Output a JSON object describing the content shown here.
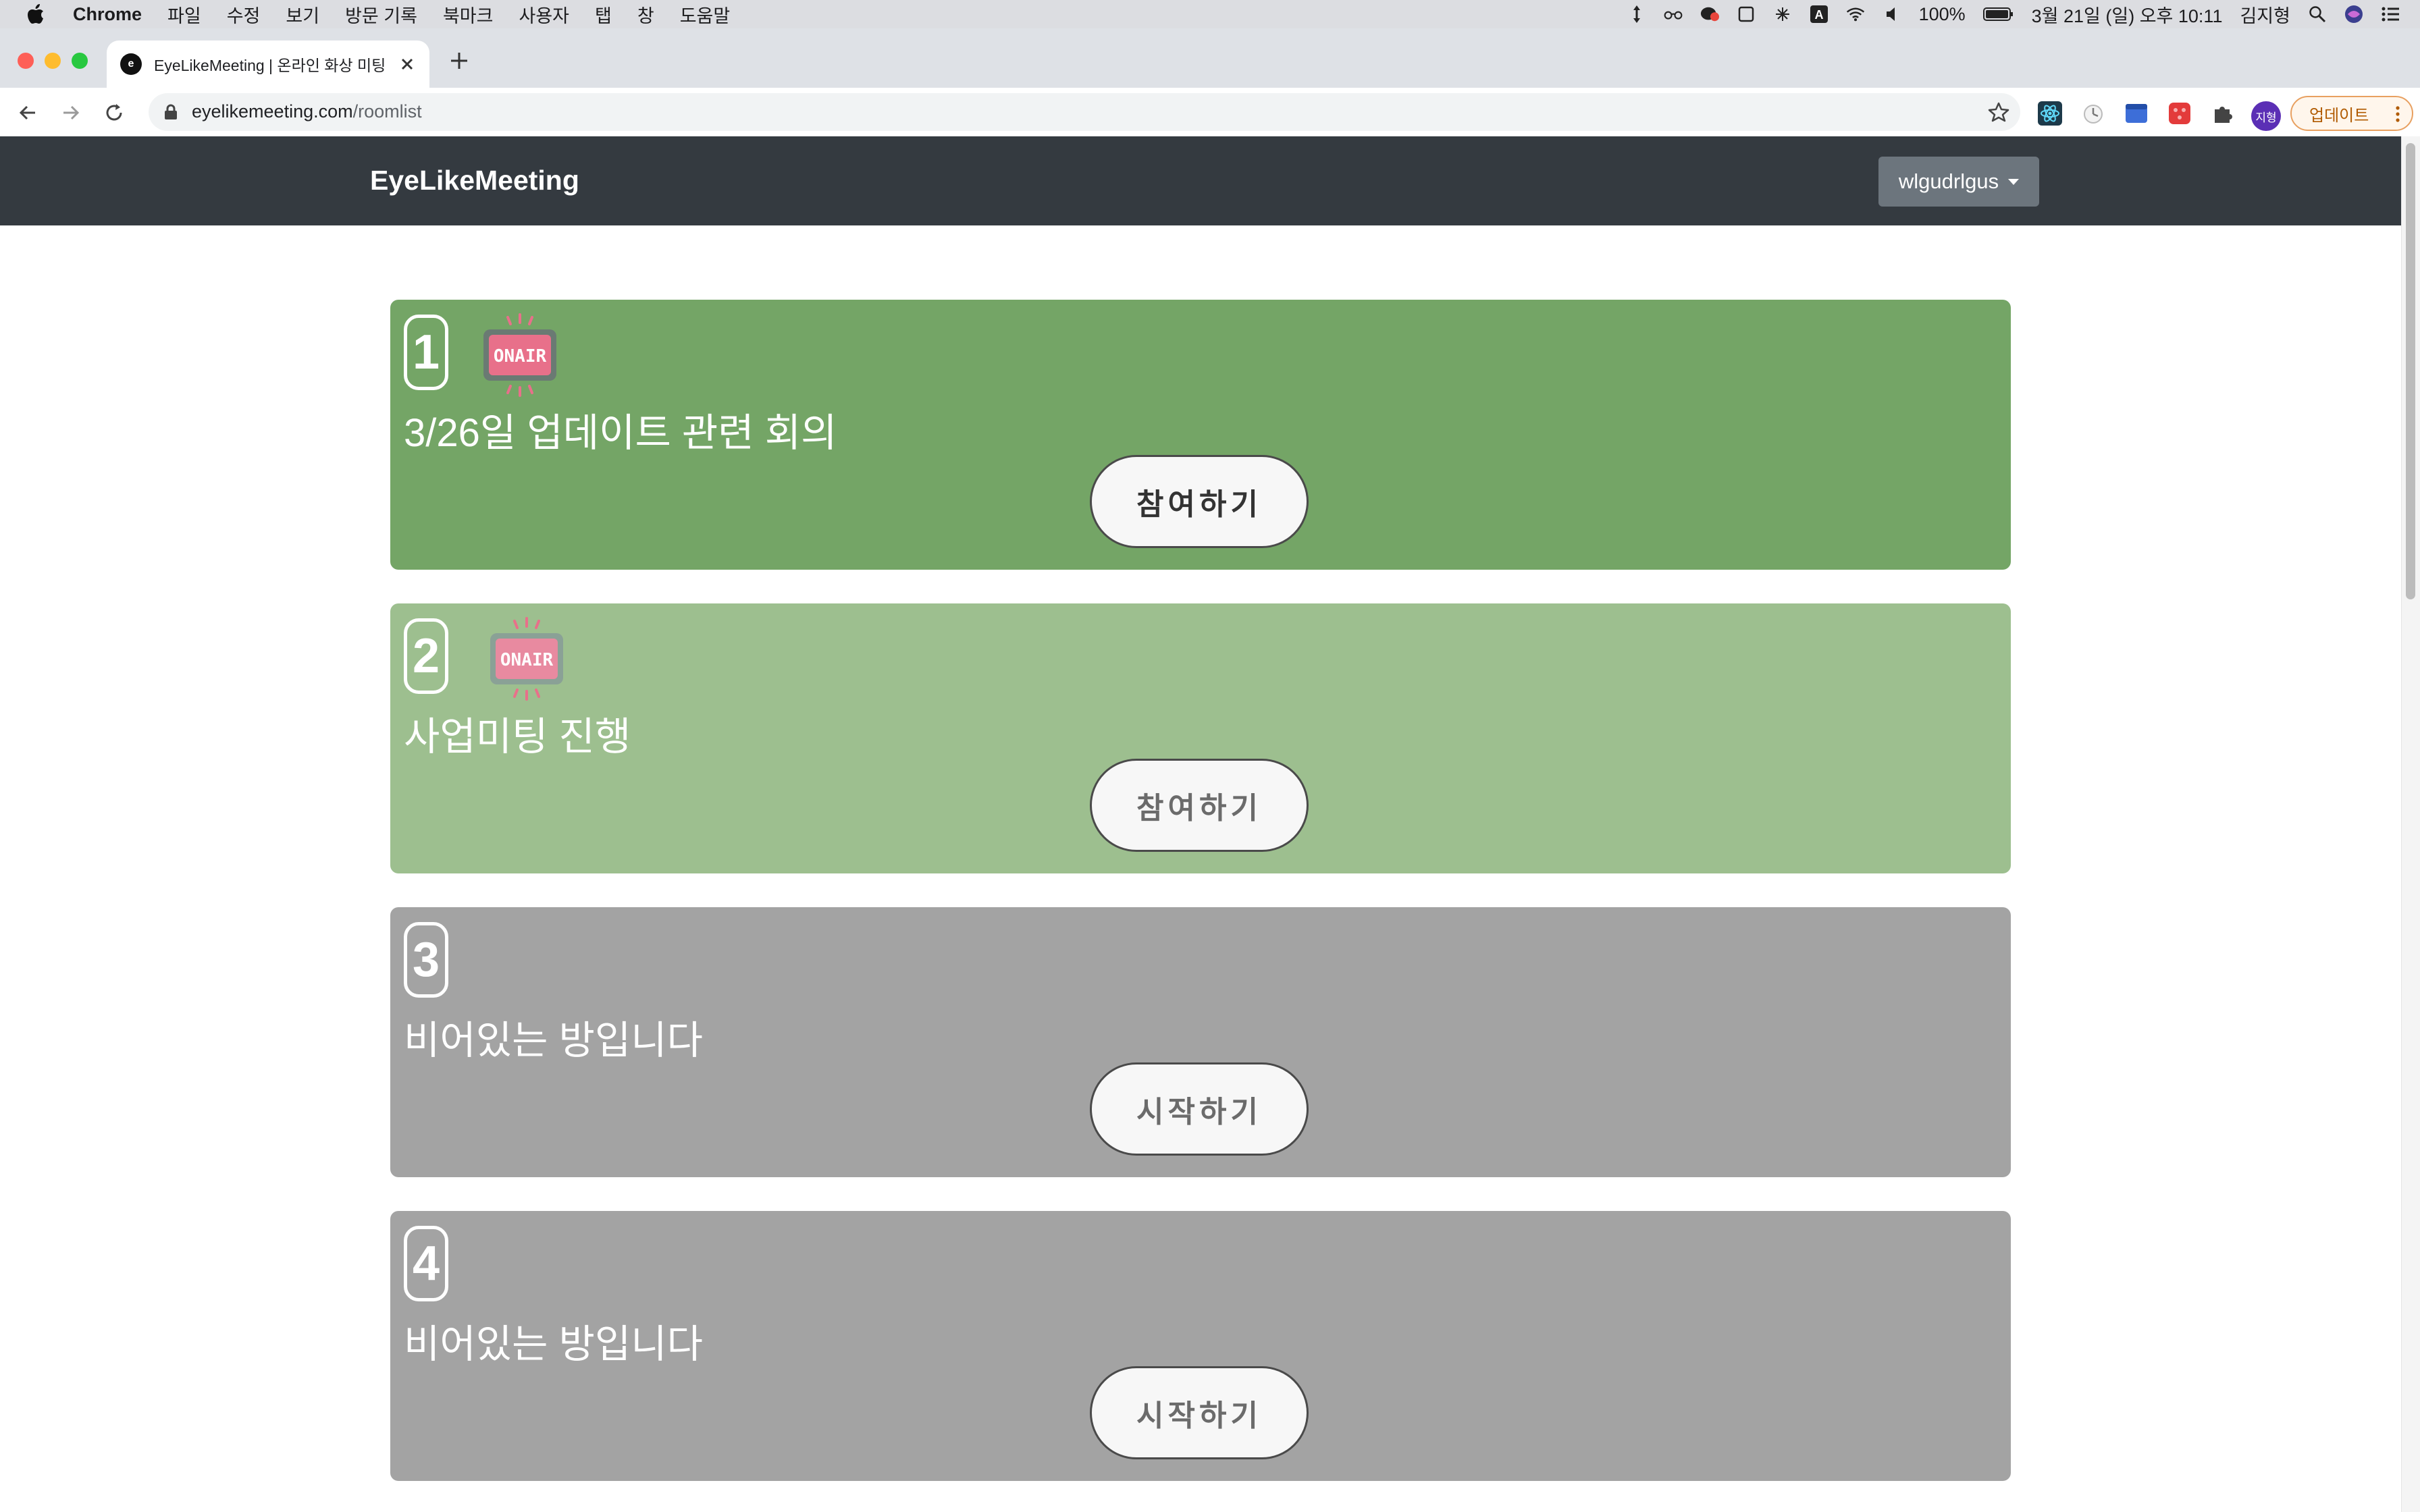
{
  "menubar": {
    "app_name": "Chrome",
    "menus": [
      "파일",
      "수정",
      "보기",
      "방문 기록",
      "북마크",
      "사용자",
      "탭",
      "창",
      "도움말"
    ],
    "battery": "100%",
    "datetime": "3월 21일 (일) 오후 10:11",
    "user": "김지형"
  },
  "browser": {
    "tab_title": "EyeLikeMeeting | 온라인 화상 미팅",
    "url_host": "eyelikemeeting.com",
    "url_path": "/roomlist",
    "profile_initials": "지형",
    "update_label": "업데이트"
  },
  "site": {
    "brand": "EyeLikeMeeting",
    "username": "wlgudrlgus"
  },
  "rooms": [
    {
      "number": "1",
      "title": "3/26일 업데이트 관련 회의",
      "button": "참여하기",
      "on_air": true,
      "status": "active"
    },
    {
      "number": "2",
      "title": "사업미팅 진행",
      "button": "참여하기",
      "on_air": true,
      "status": "live"
    },
    {
      "number": "3",
      "title": "비어있는 방입니다",
      "button": "시작하기",
      "on_air": false,
      "status": "empty"
    },
    {
      "number": "4",
      "title": "비어있는 방입니다",
      "button": "시작하기",
      "on_air": false,
      "status": "empty"
    }
  ],
  "colors": {
    "navbar": "#343a40",
    "room_active": "#74a566",
    "room_live": "#9dbf8f",
    "room_empty": "#a3a3a3",
    "dropdown": "#6c757d",
    "onair_sign": "#e8708a"
  },
  "icons": {
    "onair": "onair-sign-icon"
  }
}
